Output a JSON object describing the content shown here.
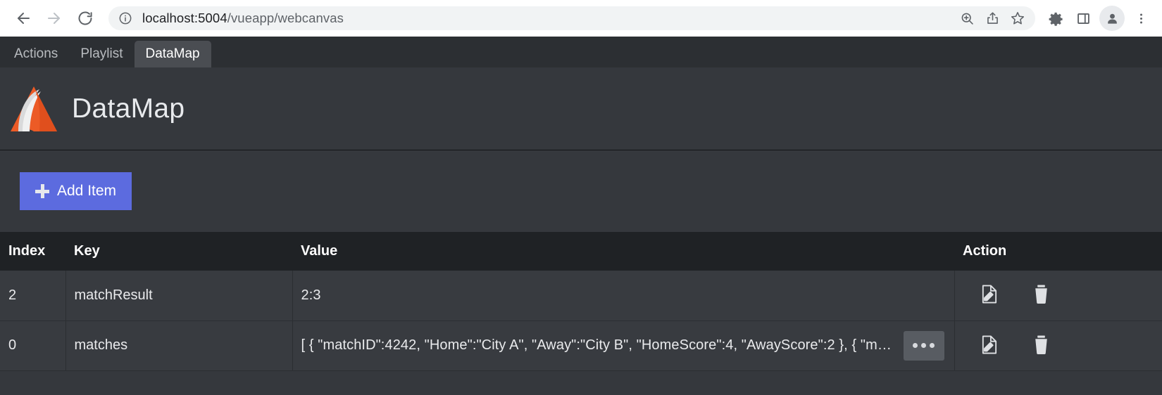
{
  "browser": {
    "back_icon": "back-arrow-icon",
    "forward_icon": "forward-arrow-icon",
    "reload_icon": "reload-icon",
    "info_icon": "info-circle-icon",
    "url_host": "localhost:5004",
    "url_path": "/vueapp/webcanvas",
    "url_full": "localhost:5004/vueapp/webcanvas",
    "omnibox_icons": [
      "zoom-in-icon",
      "share-icon",
      "bookmark-star-icon"
    ],
    "toolbar_icons": [
      "extensions-puzzle-icon",
      "side-panel-icon",
      "profile-avatar-icon",
      "menu-kebab-icon"
    ]
  },
  "tabs": [
    {
      "label": "Actions",
      "active": false
    },
    {
      "label": "Playlist",
      "active": false
    },
    {
      "label": "DataMap",
      "active": true
    }
  ],
  "header": {
    "logo_icon": "datamap-mountain-logo",
    "title": "DataMap",
    "logo_colors": {
      "orange": "#ec5b26",
      "silver": "#d9dadb"
    }
  },
  "toolbar": {
    "add_item_label": "Add Item",
    "add_item_icon": "plus-icon",
    "accent_color": "#5c6bdf"
  },
  "table": {
    "columns": [
      "Index",
      "Key",
      "Value",
      "Action"
    ],
    "rows": [
      {
        "index": "2",
        "key": "matchResult",
        "value": "2:3",
        "has_more": false,
        "edit_icon": "edit-document-icon",
        "delete_icon": "trash-icon"
      },
      {
        "index": "0",
        "key": "matches",
        "value": "[ { \"matchID\":4242, \"Home\":\"City A\", \"Away\":\"City B\", \"HomeScore\":4, \"AwayScore\":2 }, { \"match…",
        "has_more": true,
        "more_label": "•••",
        "edit_icon": "edit-document-icon",
        "delete_icon": "trash-icon"
      }
    ]
  }
}
